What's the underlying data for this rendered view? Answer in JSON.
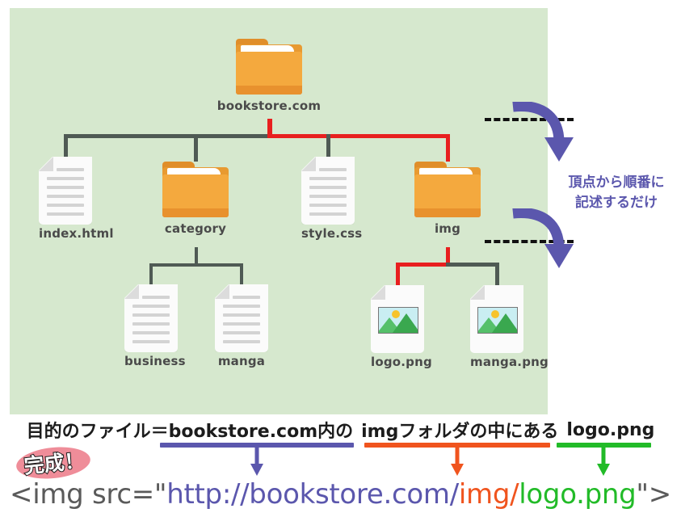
{
  "diagram": {
    "background_color": "#d6e8ce",
    "root": {
      "label": "bookstore.com",
      "icon": "folder-icon"
    },
    "level2": [
      {
        "label": "index.html",
        "icon": "document-icon"
      },
      {
        "label": "category",
        "icon": "folder-icon"
      },
      {
        "label": "style.css",
        "icon": "document-icon"
      },
      {
        "label": "img",
        "icon": "folder-icon"
      }
    ],
    "category_children": [
      {
        "label": "business",
        "icon": "document-icon"
      },
      {
        "label": "manga",
        "icon": "document-icon"
      }
    ],
    "img_children": [
      {
        "label": "logo.png",
        "icon": "image-file-icon"
      },
      {
        "label": "manga.png",
        "icon": "image-file-icon"
      }
    ],
    "highlight_path_color": "#e81f1f",
    "connector_color": "#4f5a54"
  },
  "side_note": {
    "line1": "頂点から順番に",
    "line2": "記述するだけ",
    "color": "#5b57ad"
  },
  "caption": {
    "part1": "目的のファイル＝bookstore.com内の",
    "part2": "imgフォルダの中にある",
    "part3": "logo.png"
  },
  "stamp": {
    "text": "完成！",
    "blob_color": "#ef8d99"
  },
  "code": {
    "prefix": "<img src=\"",
    "url_host": "http://bookstore.com/",
    "url_dir": "img/",
    "url_file": "logo.png",
    "suffix": "\">"
  },
  "colors": {
    "purple": "#5b57ad",
    "orange": "#f0541e",
    "green": "#22bb28",
    "red": "#e81f1f",
    "folder": "#f4a93e"
  }
}
